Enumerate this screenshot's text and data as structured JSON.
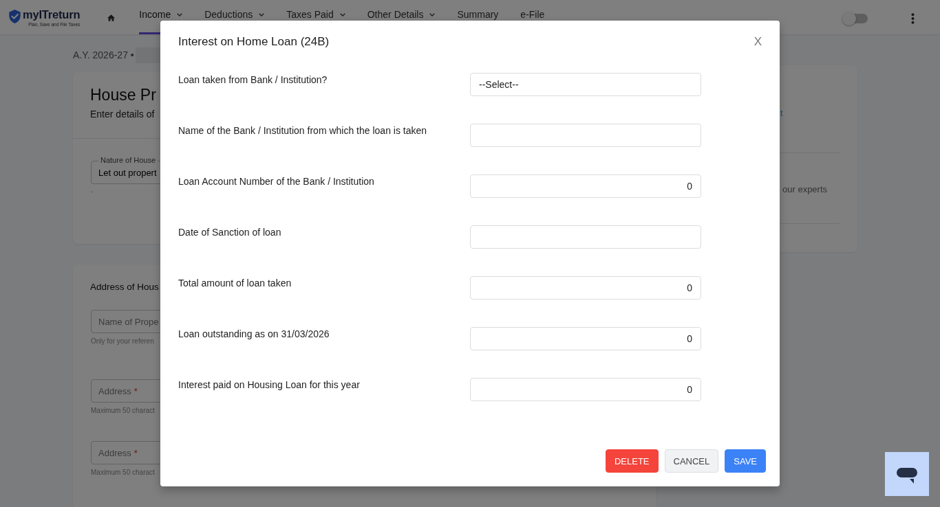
{
  "header": {
    "logo": {
      "name": "myITreturn",
      "tagline": "Plan, Save and File Taxes"
    },
    "nav": [
      {
        "label": "Income",
        "dropdown": true,
        "selected": true
      },
      {
        "label": "Deductions",
        "dropdown": true,
        "selected": false
      },
      {
        "label": "Taxes Paid",
        "dropdown": true,
        "selected": false
      },
      {
        "label": "Other Details",
        "dropdown": true,
        "selected": false
      },
      {
        "label": "Summary",
        "dropdown": false,
        "selected": false
      },
      {
        "label": "e-File",
        "dropdown": false,
        "selected": false
      }
    ],
    "theme_toggle": {
      "on": false
    }
  },
  "page": {
    "assessment_year": "A.Y. 2026-27 •",
    "house_property": {
      "title": "House Pr",
      "subtitle": "Enter details of",
      "nature_field": {
        "label": "Nature of House",
        "value": "Let out propert",
        "note": "-"
      }
    },
    "address": {
      "title": "Address of Hous",
      "fields": [
        {
          "label": "Name of Prope",
          "helper": "Only for your referen"
        },
        {
          "label": "Address",
          "required_mark": "*",
          "helper": "Maximum 50 charact"
        },
        {
          "label": "Address",
          "required_mark": "*",
          "helper": "Maximum 50 charact"
        }
      ]
    },
    "side_card": {
      "link": "t",
      "text": "our experts"
    }
  },
  "dialog": {
    "title": "Interest on Home Loan (24B)",
    "close": "X",
    "fields": [
      {
        "label": "Loan taken from Bank / Institution?",
        "kind": "select",
        "value": "--Select--"
      },
      {
        "label": "Name of the Bank / Institution from which the loan is taken",
        "kind": "text"
      },
      {
        "label": "Loan Account Number of the Bank / Institution",
        "kind": "number",
        "value": "0"
      },
      {
        "label": "Date of Sanction of loan",
        "kind": "date"
      },
      {
        "label": "Total amount of loan taken",
        "kind": "number",
        "value": "0"
      },
      {
        "label": "Loan outstanding as on 31/03/2026",
        "kind": "number",
        "value": "0"
      },
      {
        "label": "Interest paid on Housing Loan for this year",
        "kind": "number",
        "value": "0"
      }
    ],
    "buttons": [
      {
        "label": "DELETE",
        "kind": "danger"
      },
      {
        "label": "CANCEL",
        "kind": "secondary"
      },
      {
        "label": "SAVE",
        "kind": "primary"
      }
    ]
  }
}
